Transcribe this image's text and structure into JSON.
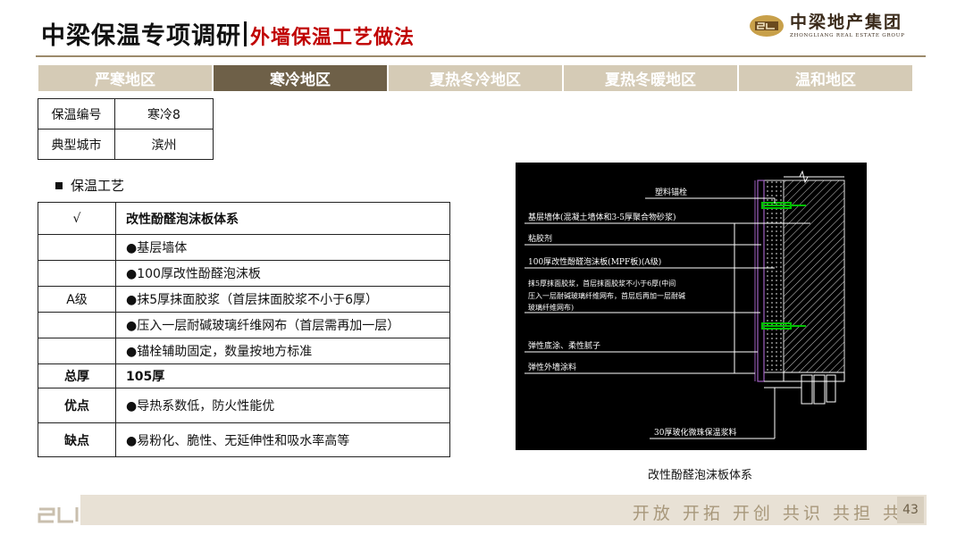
{
  "header": {
    "title": "中梁保温专项调研",
    "subtitle": "外墙保温工艺做法"
  },
  "logo": {
    "name_cn": "中梁地产集团",
    "name_en": "ZHONGLIANG REAL ESTATE GROUP"
  },
  "tabs": [
    {
      "label": "严寒地区",
      "active": false
    },
    {
      "label": "寒冷地区",
      "active": true
    },
    {
      "label": "夏热冬冷地区",
      "active": false
    },
    {
      "label": "夏热冬暖地区",
      "active": false
    },
    {
      "label": "温和地区",
      "active": false
    }
  ],
  "info_table": [
    {
      "key": "保温编号",
      "value": "寒冷8"
    },
    {
      "key": "典型城市",
      "value": "滨州"
    }
  ],
  "section_title": "保温工艺",
  "process_table": {
    "check_mark": "√",
    "system_name": "改性酚醛泡沫板体系",
    "grade_label": "A级",
    "layers": [
      "●基层墙体",
      "●100厚改性酚醛泡沫板",
      "●抹5厚抹面胶浆（首层抹面胶浆不小于6厚）",
      "●压入一层耐碱玻璃纤维网布（首层需再加一层）",
      "●锚栓辅助固定，数量按地方标准"
    ],
    "total_thickness_label": "总厚",
    "total_thickness_value": "105厚",
    "advantages_label": "优点",
    "advantages_value": "●导热系数低，防火性能优",
    "disadvantages_label": "缺点",
    "disadvantages_value": "●易粉化、脆性、无延伸性和吸水率高等"
  },
  "drawing": {
    "labels": [
      "塑料锚栓",
      "基层墙体(混凝土墙体和3-5厚聚合物砂浆)",
      "粘胶剂",
      "100厚改性酚醛泡沫板(MPF板)(A级)",
      "抹5厚抹面胶浆，首层抹面胶浆不小于6厚(中间",
      "压入一层耐碱玻璃纤维网布，首层后再加一层耐碱",
      "玻璃纤维网布)",
      "弹性底涂、柔性腻子",
      "弹性外墙涂料",
      "30厚玻化微珠保温浆料"
    ],
    "caption": "改性酚醛泡沫板体系"
  },
  "footer": {
    "slogan": "开放 开拓 开创 共识 共担 共享",
    "page_number": "43"
  },
  "colors": {
    "accent_red": "#c00000",
    "tab_active": "#6e6048",
    "tab_inactive": "#d5cbb6",
    "footer_bar": "#e8e1d5",
    "drawing_line": "#ffffff",
    "drawing_hatch": "#00c000",
    "drawing_purple": "#a060c0"
  }
}
